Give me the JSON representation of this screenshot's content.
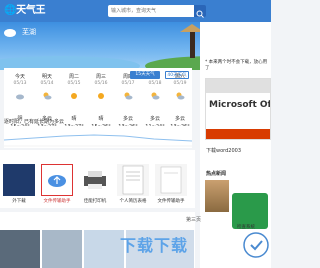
{
  "header": {
    "logo": "🌐天气王",
    "search_placeholder": "输入城市，查询天气"
  },
  "banner": {
    "city": "芜湖"
  },
  "forecast": {
    "button_primary": "15天天气",
    "button_secondary": "40天天气",
    "days": [
      {
        "label": "今天",
        "date": "05/13",
        "cond": "阴",
        "temp": "15~24°"
      },
      {
        "label": "明天",
        "date": "05/14",
        "cond": "多云",
        "temp": "13~27°"
      },
      {
        "label": "周二",
        "date": "05/15",
        "cond": "晴",
        "temp": "13~27°"
      },
      {
        "label": "周三",
        "date": "05/16",
        "cond": "晴",
        "temp": "15~26°"
      },
      {
        "label": "周四",
        "date": "05/17",
        "cond": "多云",
        "temp": "13~26°"
      },
      {
        "label": "周五",
        "date": "05/18",
        "cond": "多云",
        "temp": "11~24°"
      },
      {
        "label": "周六",
        "date": "05/19",
        "cond": "多云",
        "temp": "13~26°"
      }
    ],
    "hourly_label": "逐时阳，已有延长期为多云"
  },
  "apps": [
    {
      "label": "外下载",
      "color": "#1f3a6b"
    },
    {
      "label": "文件传输助手",
      "color": "#4a7fd0"
    },
    {
      "label": "佳能打印机",
      "color": "#d8d8d8"
    },
    {
      "label": "个人简历表格",
      "color": "#e8e8e8"
    },
    {
      "label": "文件传输助手",
      "color": "#f0f0f0"
    }
  ],
  "right": {
    "ad_text": "* 本来两个时不会下载，放心用了",
    "office_word": "Microsoft Offi",
    "download_title": "下载word2003",
    "hot_title": "热点新闻",
    "hot_caption": "检查系统"
  },
  "bottom": {
    "page_label": "第三页",
    "watermark": "下载下载"
  }
}
